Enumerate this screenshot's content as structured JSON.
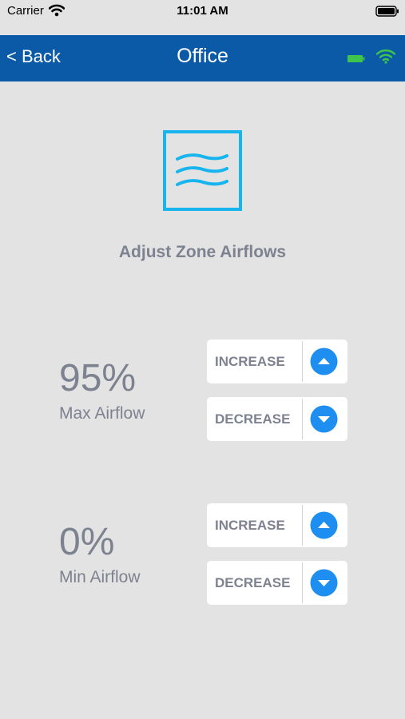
{
  "status_bar": {
    "carrier": "Carrier",
    "time": "11:01 AM"
  },
  "nav": {
    "back_label": "< Back",
    "title": "Office"
  },
  "heading": "Adjust Zone Airflows",
  "max_airflow": {
    "value": "95%",
    "label": "Max Airflow",
    "increase_label": "INCREASE",
    "decrease_label": "DECREASE"
  },
  "min_airflow": {
    "value": "0%",
    "label": "Min Airflow",
    "increase_label": "INCREASE",
    "decrease_label": "DECREASE"
  },
  "colors": {
    "nav_background": "#0b5aa7",
    "page_background": "#e3e3e3",
    "accent_blue": "#1e8ef0",
    "icon_cyan": "#17b4ee",
    "status_green": "#3fc54a",
    "text_gray": "#7d8290"
  },
  "icons": {
    "status_wifi": "wifi-icon",
    "status_battery": "battery-icon",
    "nav_battery": "battery-icon",
    "nav_wifi": "wifi-icon",
    "airflow": "airflow-icon",
    "increase": "chevron-up-icon",
    "decrease": "chevron-down-icon"
  }
}
